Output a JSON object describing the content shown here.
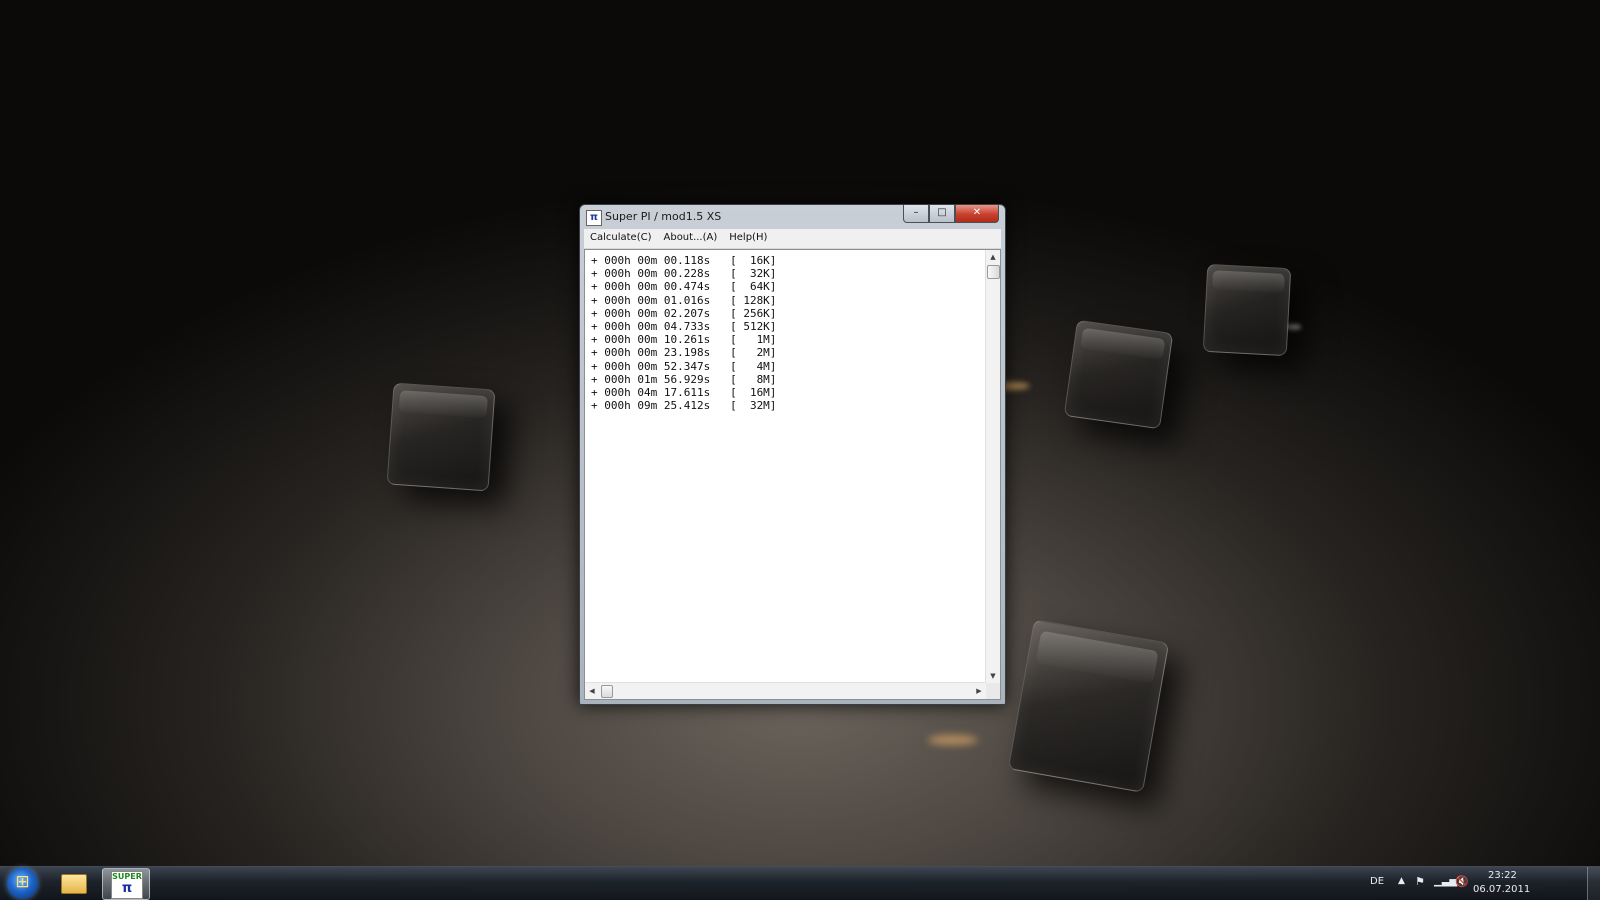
{
  "window": {
    "title": "Super PI / mod1.5 XS",
    "app_icon": "pi-icon",
    "controls": {
      "minimize": "–",
      "maximize": "□",
      "close": "✕"
    }
  },
  "menu": [
    {
      "label": "Calculate(C)"
    },
    {
      "label": "About...(A)"
    },
    {
      "label": "Help(H)"
    }
  ],
  "results": [
    "+ 000h 00m 00.118s   [  16K]",
    "+ 000h 00m 00.228s   [  32K]",
    "+ 000h 00m 00.474s   [  64K]",
    "+ 000h 00m 01.016s   [ 128K]",
    "+ 000h 00m 02.207s   [ 256K]",
    "+ 000h 00m 04.733s   [ 512K]",
    "+ 000h 00m 10.261s   [   1M]",
    "+ 000h 00m 23.198s   [   2M]",
    "+ 000h 00m 52.347s   [   4M]",
    "+ 000h 01m 56.929s   [   8M]",
    "+ 000h 04m 17.611s   [  16M]",
    "+ 000h 09m 25.412s   [  32M]"
  ],
  "taskbar": {
    "superpi_icon": {
      "top": "SUPER",
      "bottom": "π"
    },
    "language": "DE",
    "clock": {
      "time": "23:22",
      "date": "06.07.2011"
    }
  }
}
